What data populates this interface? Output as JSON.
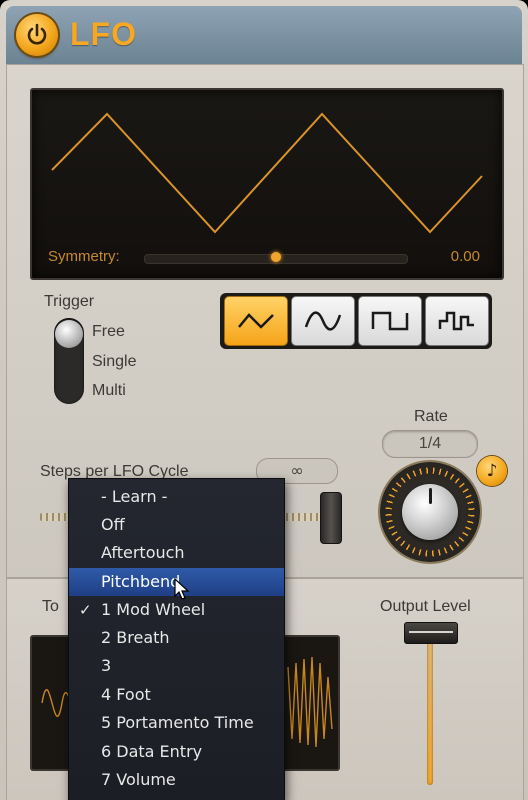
{
  "header": {
    "title": "LFO",
    "power_icon": "power-icon"
  },
  "symmetry": {
    "label": "Symmetry:",
    "value": "0.00",
    "level": 0.5
  },
  "trigger": {
    "label": "Trigger",
    "options": [
      "Free",
      "Single",
      "Multi"
    ],
    "selected": "Free"
  },
  "waveforms": {
    "buttons": [
      "triangle-wave-icon",
      "sine-wave-icon",
      "square-wave-icon",
      "random-wave-icon"
    ],
    "selected": "triangle-wave-icon"
  },
  "steps": {
    "label": "Steps per LFO Cycle",
    "value": "∞"
  },
  "rate": {
    "label": "Rate",
    "value": "1/4",
    "sync_icon": "note-icon",
    "sync_glyph": "♪"
  },
  "output": {
    "to_label": "To",
    "level_label": "Output Level"
  },
  "menu": {
    "items": [
      {
        "label": "- Learn -",
        "checked": false,
        "highlighted": false
      },
      {
        "label": "Off",
        "checked": false,
        "highlighted": false
      },
      {
        "label": "Aftertouch",
        "checked": false,
        "highlighted": false
      },
      {
        "label": "Pitchbend",
        "checked": false,
        "highlighted": true
      },
      {
        "label": "1 Mod Wheel",
        "checked": true,
        "highlighted": false
      },
      {
        "label": "2 Breath",
        "checked": false,
        "highlighted": false
      },
      {
        "label": "3",
        "checked": false,
        "highlighted": false
      },
      {
        "label": "4 Foot",
        "checked": false,
        "highlighted": false
      },
      {
        "label": "5 Portamento Time",
        "checked": false,
        "highlighted": false
      },
      {
        "label": "6 Data Entry",
        "checked": false,
        "highlighted": false
      },
      {
        "label": "7 Volume",
        "checked": false,
        "highlighted": false
      }
    ],
    "check_glyph": "✓"
  },
  "colors": {
    "accent": "#f2a52c",
    "header": "#7d93a4",
    "menu_highlight": "#2a4f9c"
  }
}
